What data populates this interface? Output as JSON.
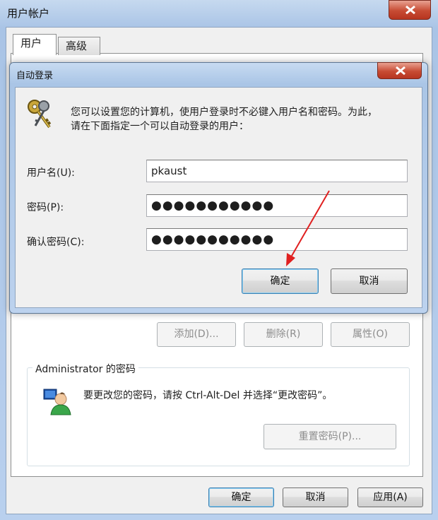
{
  "outer_window": {
    "title": "用户帐户",
    "tabs": [
      {
        "label": "用户"
      },
      {
        "label": "高级"
      }
    ],
    "buttons": {
      "add": "添加(D)...",
      "delete": "删除(R)",
      "properties": "属性(O)"
    },
    "password_group": {
      "title": "Administrator 的密码",
      "text": "要更改您的密码，请按 Ctrl-Alt-Del 并选择“更改密码”。",
      "reset_button": "重置密码(P)..."
    },
    "footer": {
      "ok": "确定",
      "cancel": "取消",
      "apply": "应用(A)"
    }
  },
  "autologon_dialog": {
    "title": "自动登录",
    "description_line1": "您可以设置您的计算机，使用户登录时不必键入用户名和密码。为此，",
    "description_line2": "请在下面指定一个可以自动登录的用户：",
    "fields": {
      "username": {
        "label": "用户名(U):",
        "value": "pkaust"
      },
      "password": {
        "label": "密码(P):",
        "value": "●●●●●●●●●●●"
      },
      "confirm": {
        "label": "确认密码(C):",
        "value": "●●●●●●●●●●●"
      }
    },
    "buttons": {
      "ok": "确定",
      "cancel": "取消"
    }
  },
  "icons": {
    "keys": "keys-icon",
    "user": "user-icon",
    "close": "close-icon",
    "arrow": "arrow-annotation"
  },
  "colors": {
    "close_button": "#c74b33",
    "arrow": "#e02020",
    "title_bar": "#bcd2ee"
  }
}
